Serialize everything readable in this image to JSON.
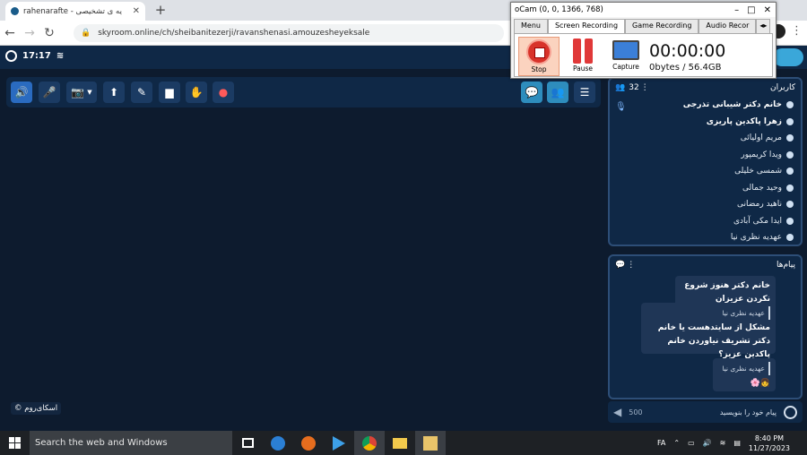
{
  "browser": {
    "tab_title": "rahenarafte - یه ی تشخیصی",
    "url": "skyroom.online/ch/sheibanitezerji/ravanshenasi.amouzesheyeksale"
  },
  "header": {
    "time": "17:17"
  },
  "ocam": {
    "title": "oCam (0, 0, 1366, 768)",
    "tabs": [
      "Menu",
      "Screen Recording",
      "Game Recording",
      "Audio Recor"
    ],
    "stop_label": "Stop",
    "pause_label": "Pause",
    "capture_label": "Capture",
    "timer": "00:00:00",
    "size": "0bytes / 56.4GB"
  },
  "users_panel": {
    "title": "کاربران",
    "count": "32",
    "users": [
      {
        "name": "خانم دکتر شیبانی تذرجی",
        "bold": true
      },
      {
        "name": "زهرا پاکدین پاریزی",
        "bold": true
      },
      {
        "name": "مریم اولیائی",
        "bold": false
      },
      {
        "name": "ویدا کریمپور",
        "bold": false
      },
      {
        "name": "شمسی خلیلی",
        "bold": false
      },
      {
        "name": "وحید جمالی",
        "bold": false
      },
      {
        "name": "ناهید رمضانی",
        "bold": false
      },
      {
        "name": "ایدا مکی آبادی",
        "bold": false
      },
      {
        "name": "عهدیه نظری نیا",
        "bold": false
      }
    ]
  },
  "messages_panel": {
    "title": "پیام‌ها",
    "messages": [
      {
        "sender": "",
        "text": "خانم دکتر هنوز شروع نکردن عزیزان"
      },
      {
        "sender": "عهدیه نظری نیا",
        "text": "مشکل از سایتدهست یا خانم دکتر تشریف نیاوردن خانم پاکدین عزیز؟"
      },
      {
        "sender": "عهدیه نظری نیا",
        "text": "👧🌸"
      }
    ],
    "input_placeholder": "پیام خود را بنویسید",
    "char_limit": "500"
  },
  "brand": "اسکای‌روم",
  "taskbar": {
    "search_placeholder": "Search the web and Windows",
    "lang": "FA",
    "time": "8:40 PM",
    "date": "11/27/2023"
  }
}
